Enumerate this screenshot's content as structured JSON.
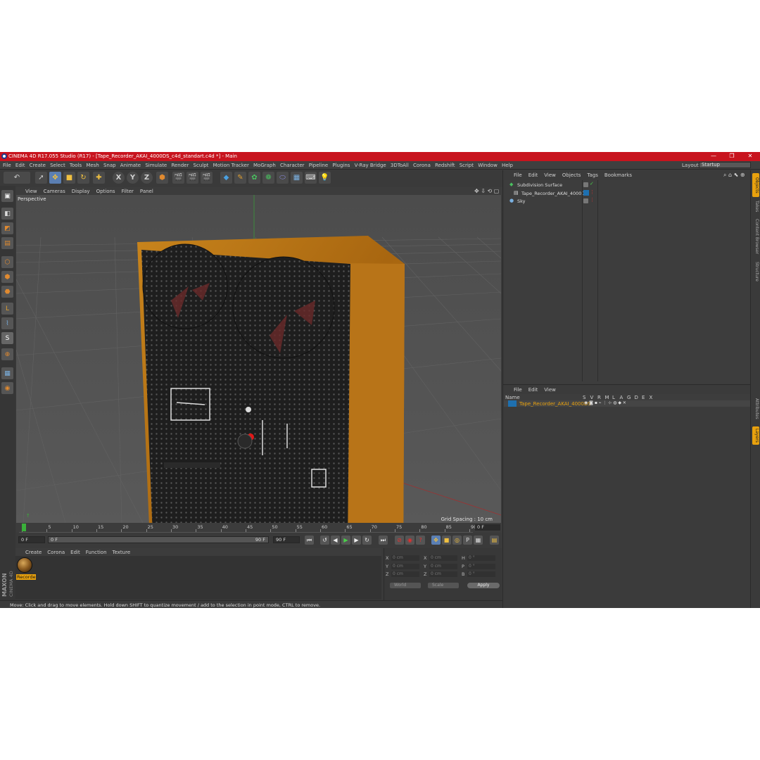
{
  "window": {
    "title": "CINEMA 4D R17.055 Studio (R17) - [Tape_Recorder_AKAI_4000DS_c4d_standart.c4d *] - Main",
    "controls": [
      "—",
      "❐",
      "✕"
    ]
  },
  "menubar": {
    "items": [
      "File",
      "Edit",
      "Create",
      "Select",
      "Tools",
      "Mesh",
      "Snap",
      "Animate",
      "Simulate",
      "Render",
      "Sculpt",
      "Motion Tracker",
      "MoGraph",
      "Character",
      "Pipeline",
      "Plugins",
      "V-Ray Bridge",
      "3DToAll",
      "Corona",
      "Redshift",
      "Script",
      "Window",
      "Help"
    ],
    "layout_label": "Layout:",
    "layout_value": "Startup"
  },
  "toolbar": {
    "axis_x": "X",
    "axis_y": "Y",
    "axis_z": "Z"
  },
  "viewport": {
    "menu": [
      "View",
      "Cameras",
      "Display",
      "Options",
      "Filter",
      "Panel"
    ],
    "label": "Perspective",
    "grid_spacing": "Grid Spacing : 10 cm"
  },
  "timeline": {
    "ticks": [
      "0",
      "5",
      "10",
      "15",
      "20",
      "25",
      "30",
      "35",
      "40",
      "45",
      "50",
      "55",
      "60",
      "65",
      "70",
      "75",
      "80",
      "85",
      "90"
    ],
    "current_frame": "0 F",
    "start_field": "0 F",
    "range_start": "0 F",
    "range_end": "90 F",
    "end_field": "90 F"
  },
  "materials": {
    "menu": [
      "Create",
      "Corona",
      "Edit",
      "Function",
      "Texture"
    ],
    "items": [
      {
        "label": "Recorde"
      }
    ]
  },
  "coordinates": {
    "rows": [
      {
        "a": "X",
        "av": "0 cm",
        "b": "X",
        "bv": "0 cm",
        "c": "H",
        "cv": "0 °"
      },
      {
        "a": "Y",
        "av": "0 cm",
        "b": "Y",
        "bv": "0 cm",
        "c": "P",
        "cv": "0 °"
      },
      {
        "a": "Z",
        "av": "0 cm",
        "b": "Z",
        "bv": "0 cm",
        "c": "B",
        "cv": "0 °"
      }
    ],
    "mode_world": "World",
    "mode_scale": "Scale",
    "apply": "Apply"
  },
  "status": {
    "text": "Move: Click and drag to move elements. Hold down SHIFT to quantize movement / add to the selection in point mode, CTRL to remove."
  },
  "object_manager": {
    "menu": [
      "File",
      "Edit",
      "View",
      "Objects",
      "Tags",
      "Bookmarks"
    ],
    "objects": [
      {
        "name": "Subdivision Surface",
        "color": "#dddddd"
      },
      {
        "name": "Tape_Recorder_AKAI_4000DS",
        "color": "#dddddd"
      },
      {
        "name": "Sky",
        "color": "#dddddd"
      }
    ]
  },
  "layer_manager": {
    "menu": [
      "File",
      "Edit",
      "View"
    ],
    "header_name": "Name",
    "header_cols": [
      "S",
      "V",
      "R",
      "M",
      "L",
      "A",
      "G",
      "D",
      "E",
      "X"
    ],
    "layers": [
      {
        "name": "Tape_Recorder_AKAI_4000DS",
        "color": "#e8a10e"
      }
    ]
  },
  "right_tabs": [
    "Objects",
    "Takes",
    "Content Browser",
    "Structure",
    "Attributes",
    "Layers"
  ],
  "brand": {
    "maxon": "MAXON",
    "product": "CINEMA 4D"
  },
  "colors": {
    "accent": "#e8a10e",
    "titlebar": "#c8141e",
    "selection": "#5b7fb3"
  }
}
